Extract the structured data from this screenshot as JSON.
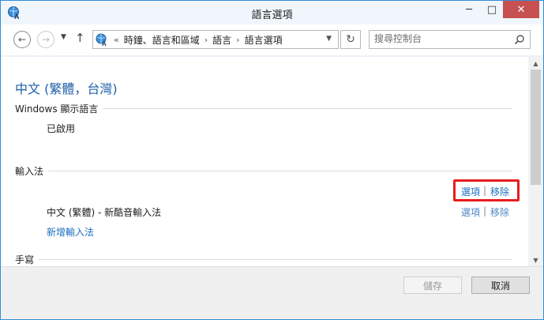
{
  "window": {
    "title": "語言選項",
    "min_glyph": "─",
    "max_glyph": "□",
    "close_glyph": "✕"
  },
  "nav": {
    "back_glyph": "←",
    "forward_glyph": "→",
    "dropdown_glyph": "▼",
    "up_glyph": "↑",
    "refresh_glyph": "↻"
  },
  "breadcrumb": {
    "overflow": "«",
    "separator": "›",
    "items": [
      "時鐘、語言和區域",
      "語言",
      "語言選項"
    ],
    "dropdown_glyph": "▼"
  },
  "search": {
    "placeholder": "搜尋控制台"
  },
  "content": {
    "language_title": "中文 (繁體，台灣)",
    "display_language_section": "Windows 顯示語言",
    "display_language_status": "已啟用",
    "input_method_section": "輸入法",
    "top_options_link": "選項",
    "top_remove_link": "移除",
    "pipe": "|",
    "ime_name": "中文 (繁體) - 新酷音輸入法",
    "ime_options_link": "選項",
    "ime_remove_link": "移除",
    "add_ime_link": "新增輸入法",
    "handwriting_section": "手寫"
  },
  "scrollbar": {
    "up_glyph": "▲",
    "down_glyph": "▼"
  },
  "footer": {
    "save_label": "儲存",
    "cancel_label": "取消"
  },
  "colors": {
    "accent": "#2f8fd6",
    "link": "#1a6ec1",
    "title_blue": "#1f5fa8",
    "highlight_red": "#e81d1d",
    "close_red": "#c75050"
  },
  "icons": {
    "app": "control-panel-globe-icon",
    "search": "magnifier-icon"
  }
}
